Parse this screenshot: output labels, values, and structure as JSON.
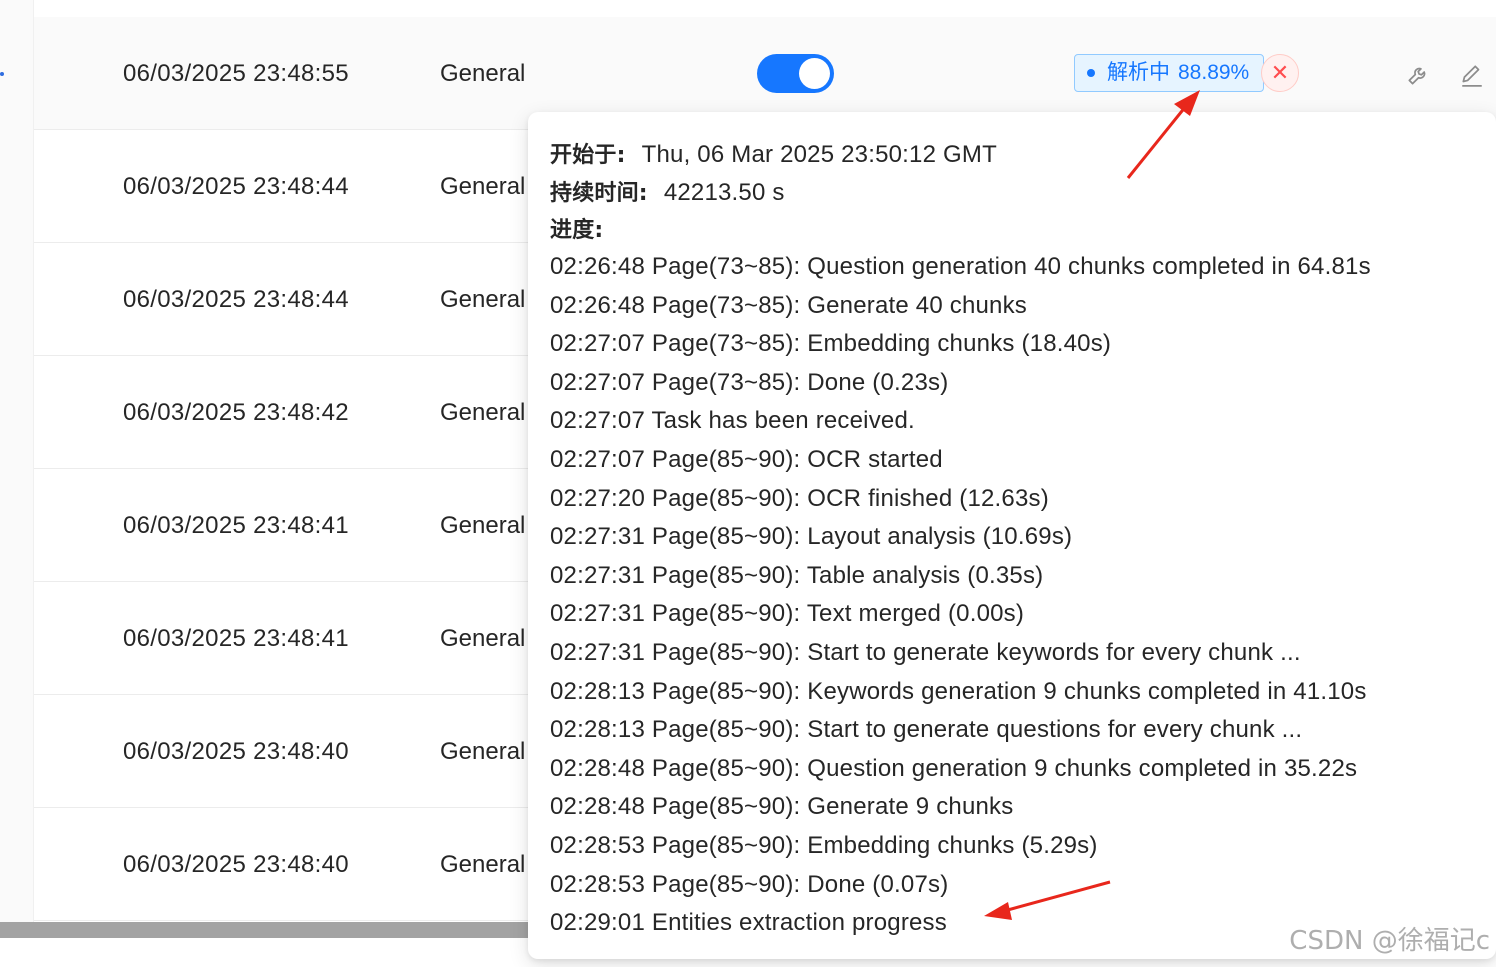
{
  "rows": [
    {
      "date": "06/03/2025 23:48:55",
      "type": "General"
    },
    {
      "date": "06/03/2025 23:48:44",
      "type": "General"
    },
    {
      "date": "06/03/2025 23:48:44",
      "type": "General"
    },
    {
      "date": "06/03/2025 23:48:42",
      "type": "General"
    },
    {
      "date": "06/03/2025 23:48:41",
      "type": "General"
    },
    {
      "date": "06/03/2025 23:48:41",
      "type": "General"
    },
    {
      "date": "06/03/2025 23:48:40",
      "type": "General"
    },
    {
      "date": "06/03/2025 23:48:40",
      "type": "General"
    }
  ],
  "status": {
    "label": "解析中",
    "percent": "88.89%",
    "enabled": true,
    "cancel_symbol": "✕"
  },
  "actions": {
    "icons": [
      "wrench-icon",
      "pencil-icon"
    ]
  },
  "popover": {
    "started_label": "开始于:",
    "started_value": "Thu, 06 Mar 2025 23:50:12 GMT",
    "duration_label": "持续时间:",
    "duration_value": "42213.50 s",
    "progress_label": "进度:",
    "log": [
      "02:26:48 Page(73~85): Question generation 40 chunks completed in 64.81s",
      "02:26:48 Page(73~85): Generate 40 chunks",
      "02:27:07 Page(73~85): Embedding chunks (18.40s)",
      "02:27:07 Page(73~85): Done (0.23s)",
      "02:27:07 Task has been received.",
      "02:27:07 Page(85~90): OCR started",
      "02:27:20 Page(85~90): OCR finished (12.63s)",
      "02:27:31 Page(85~90): Layout analysis (10.69s)",
      "02:27:31 Page(85~90): Table analysis (0.35s)",
      "02:27:31 Page(85~90): Text merged (0.00s)",
      "02:27:31 Page(85~90): Start to generate keywords for every chunk ...",
      "02:28:13 Page(85~90): Keywords generation 9 chunks completed in 41.10s",
      "02:28:13 Page(85~90): Start to generate questions for every chunk ...",
      "02:28:48 Page(85~90): Question generation 9 chunks completed in 35.22s",
      "02:28:48 Page(85~90): Generate 9 chunks",
      "02:28:53 Page(85~90): Embedding chunks (5.29s)",
      "02:28:53 Page(85~90): Done (0.07s)",
      "02:29:01 Entities extraction progress"
    ]
  },
  "watermark": "CSDN @徐福记c",
  "colors": {
    "primary": "#1677ff",
    "tag_bg": "#e6f4ff",
    "tag_border": "#91caff",
    "danger": "#ff4d4f",
    "annotation_arrow": "#e8271c"
  }
}
